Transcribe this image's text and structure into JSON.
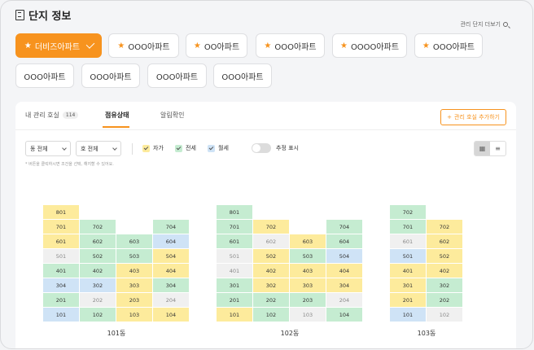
{
  "header": {
    "title": "단지 정보",
    "manage_link": "관리 단지 더보기"
  },
  "complexes": [
    {
      "label": "더비즈아파트",
      "starred": true,
      "active": true
    },
    {
      "label": "OOO아파트",
      "starred": true,
      "active": false
    },
    {
      "label": "OO아파트",
      "starred": true,
      "active": false
    },
    {
      "label": "OOO아파트",
      "starred": true,
      "active": false
    },
    {
      "label": "OOOO아파트",
      "starred": true,
      "active": false
    },
    {
      "label": "OOO아파트",
      "starred": true,
      "active": false
    },
    {
      "label": "OOO아파트",
      "starred": false,
      "active": false
    },
    {
      "label": "OOO아파트",
      "starred": false,
      "active": false
    },
    {
      "label": "OOO아파트",
      "starred": false,
      "active": false
    },
    {
      "label": "OOO아파트",
      "starred": false,
      "active": false
    }
  ],
  "tabs": [
    {
      "label": "내 관리 호실",
      "badge": "114"
    },
    {
      "label": "점유상태",
      "active": true
    },
    {
      "label": "알림확인"
    }
  ],
  "add_unit_button": "관리 호실 추가하기",
  "filters": {
    "building_select": "동 전체",
    "unit_select": "호 전체",
    "legend": [
      {
        "label": "자가",
        "color": "#fdeb9c"
      },
      {
        "label": "전세",
        "color": "#c5ecd1"
      },
      {
        "label": "월세",
        "color": "#cfe3f6"
      }
    ],
    "recommend_toggle": "추정 표시",
    "note": "* 버튼을 클릭하시면 조건을 선택, 해지할 수 있어요."
  },
  "status_colors": {
    "own": "#fdeb9c",
    "jeonse": "#c5ecd1",
    "monthly": "#cfe3f6",
    "vacant": "#f0f0f0"
  },
  "buildings": [
    {
      "name": "101동",
      "columns": [
        [
          [
            "801",
            "own"
          ],
          [
            "701",
            "own"
          ],
          [
            "601",
            "own"
          ],
          [
            "501",
            "vacant"
          ],
          [
            "401",
            "jeonse"
          ],
          [
            "304",
            "monthly"
          ],
          [
            "201",
            "jeonse"
          ],
          [
            "101",
            "monthly"
          ]
        ],
        [
          [
            "702",
            "jeonse"
          ],
          [
            "602",
            "jeonse"
          ],
          [
            "502",
            "jeonse"
          ],
          [
            "402",
            "jeonse"
          ],
          [
            "302",
            "monthly"
          ],
          [
            "202",
            "vacant"
          ],
          [
            "102",
            "jeonse"
          ]
        ],
        [
          [
            "603",
            "jeonse"
          ],
          [
            "503",
            "jeonse"
          ],
          [
            "403",
            "own"
          ],
          [
            "303",
            "own"
          ],
          [
            "203",
            "own"
          ],
          [
            "103",
            "own"
          ]
        ],
        [
          [
            "704",
            "jeonse"
          ],
          [
            "604",
            "monthly"
          ],
          [
            "504",
            "own"
          ],
          [
            "404",
            "own"
          ],
          [
            "304",
            "jeonse"
          ],
          [
            "204",
            "vacant"
          ],
          [
            "104",
            "own"
          ]
        ]
      ]
    },
    {
      "name": "102동",
      "columns": [
        [
          [
            "801",
            "jeonse"
          ],
          [
            "701",
            "jeonse"
          ],
          [
            "601",
            "jeonse"
          ],
          [
            "501",
            "vacant"
          ],
          [
            "401",
            "vacant"
          ],
          [
            "301",
            "jeonse"
          ],
          [
            "201",
            "jeonse"
          ],
          [
            "101",
            "own"
          ]
        ],
        [
          [
            "702",
            "own"
          ],
          [
            "602",
            "vacant"
          ],
          [
            "502",
            "own"
          ],
          [
            "402",
            "own"
          ],
          [
            "302",
            "own"
          ],
          [
            "202",
            "jeonse"
          ],
          [
            "102",
            "jeonse"
          ]
        ],
        [
          [
            "603",
            "own"
          ],
          [
            "503",
            "jeonse"
          ],
          [
            "403",
            "own"
          ],
          [
            "303",
            "own"
          ],
          [
            "203",
            "jeonse"
          ],
          [
            "103",
            "vacant"
          ]
        ],
        [
          [
            "704",
            "jeonse"
          ],
          [
            "604",
            "jeonse"
          ],
          [
            "504",
            "monthly"
          ],
          [
            "404",
            "own"
          ],
          [
            "304",
            "own"
          ],
          [
            "204",
            "vacant"
          ],
          [
            "104",
            "jeonse"
          ]
        ]
      ]
    },
    {
      "name": "103동",
      "columns": [
        [
          [
            "702",
            "jeonse"
          ],
          [
            "701",
            "jeonse"
          ],
          [
            "601",
            "vacant"
          ],
          [
            "501",
            "monthly"
          ],
          [
            "401",
            "own"
          ],
          [
            "301",
            "own"
          ],
          [
            "201",
            "own"
          ],
          [
            "101",
            "monthly"
          ]
        ],
        [
          [
            "702",
            "own"
          ],
          [
            "602",
            "own"
          ],
          [
            "502",
            "own"
          ],
          [
            "402",
            "own"
          ],
          [
            "302",
            "jeonse"
          ],
          [
            "202",
            "jeonse"
          ],
          [
            "102",
            "vacant"
          ]
        ]
      ]
    }
  ]
}
